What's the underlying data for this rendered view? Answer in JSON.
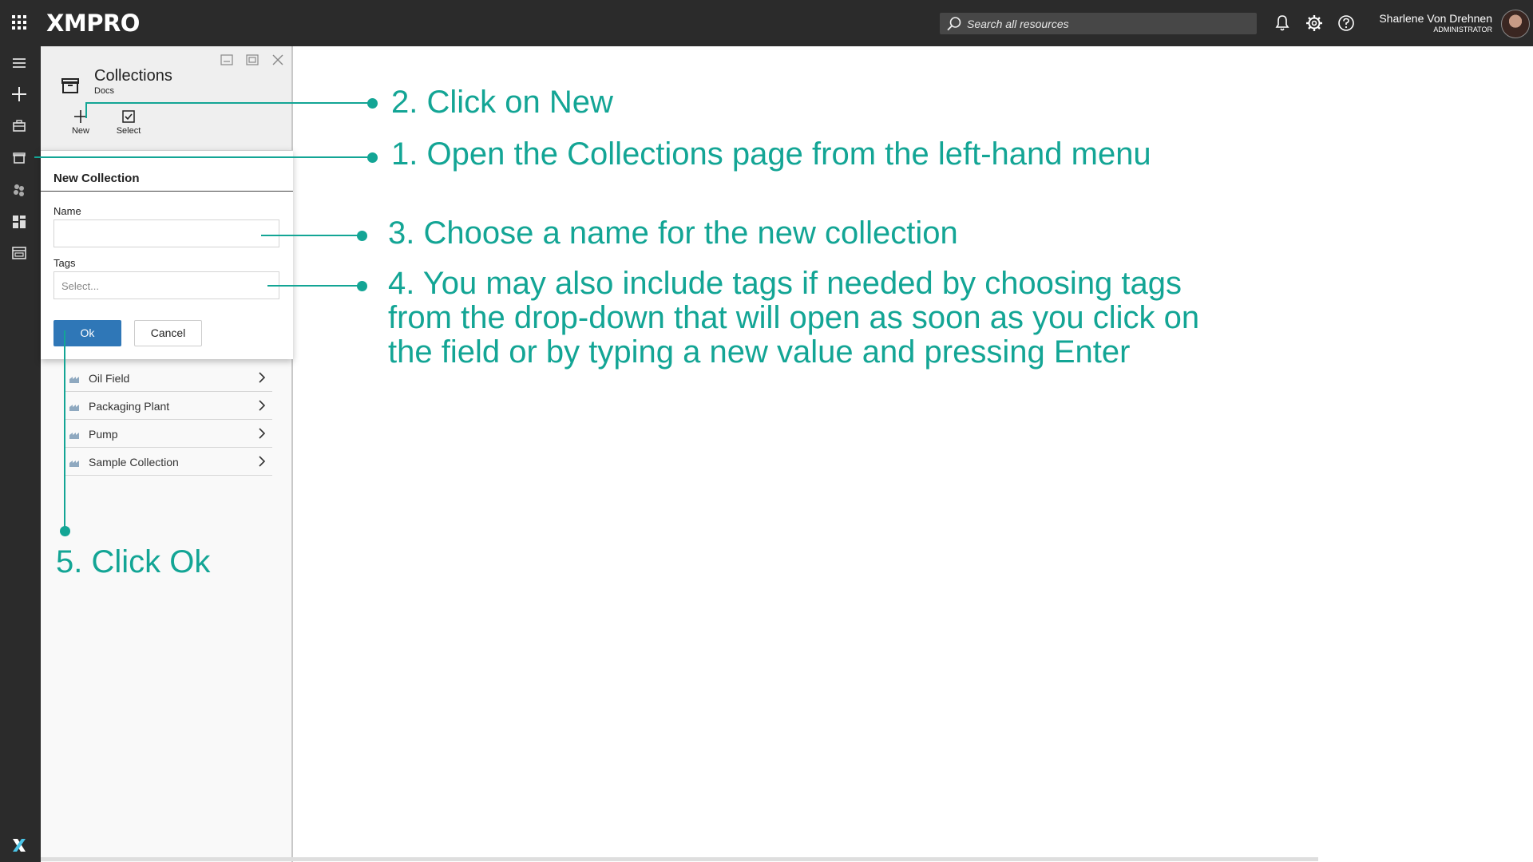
{
  "brand": {
    "logo": "XMPRO",
    "accent": "#13a595",
    "topbar_bg": "#2b2b2b"
  },
  "search": {
    "placeholder": "Search all resources"
  },
  "user": {
    "name": "Sharlene Von Drehnen",
    "role": "ADMINISTRATOR"
  },
  "top_icons": [
    "bell-icon",
    "gear-icon",
    "help-icon"
  ],
  "left_nav": [
    "hamburger-menu-icon",
    "plus-icon",
    "briefcase-icon",
    "collections-icon",
    "cubes-icon",
    "dashboard-icon",
    "calendar-icon",
    "xmpro-x-icon"
  ],
  "panel": {
    "title": "Collections",
    "subtitle": "Docs",
    "toolbar": {
      "new_label": "New",
      "select_label": "Select"
    }
  },
  "modal": {
    "title": "New Collection",
    "name_label": "Name",
    "name_value": "",
    "tags_label": "Tags",
    "tags_placeholder": "Select...",
    "ok_label": "Ok",
    "cancel_label": "Cancel"
  },
  "collections": [
    {
      "label": "Oil Field"
    },
    {
      "label": "Packaging Plant"
    },
    {
      "label": "Pump"
    },
    {
      "label": "Sample Collection"
    }
  ],
  "callouts": {
    "step1": "1. Open the Collections page from the left-hand menu",
    "step2": "2. Click on New",
    "step3": "3. Choose a name for the new collection",
    "step4_line1": "4. You may also include tags if needed by choosing tags",
    "step4_line2": "from the drop-down that will open as soon as you click on",
    "step4_line3": "the field or by typing a new value and pressing Enter",
    "step5": "5. Click Ok"
  }
}
